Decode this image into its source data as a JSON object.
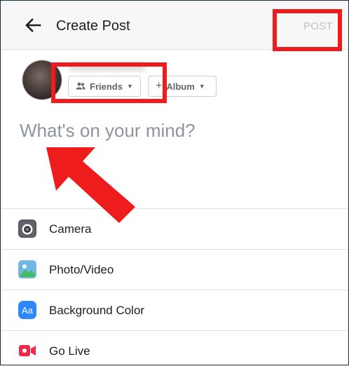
{
  "header": {
    "title": "Create Post",
    "post_label": "POST"
  },
  "composer": {
    "audience_label": "Friends",
    "album_label": "Album",
    "album_prefix": "+",
    "placeholder": "What's on your mind?"
  },
  "options": [
    {
      "label": "Camera",
      "icon": "camera-icon"
    },
    {
      "label": "Photo/Video",
      "icon": "photo-video-icon"
    },
    {
      "label": "Background Color",
      "icon": "background-color-icon"
    },
    {
      "label": "Go Live",
      "icon": "go-live-icon"
    }
  ],
  "icons": {
    "background_color_glyph": "Aa"
  },
  "colors": {
    "annotation": "#ee1c1c",
    "post_disabled": "#bec3c9",
    "placeholder": "#8d949e"
  }
}
